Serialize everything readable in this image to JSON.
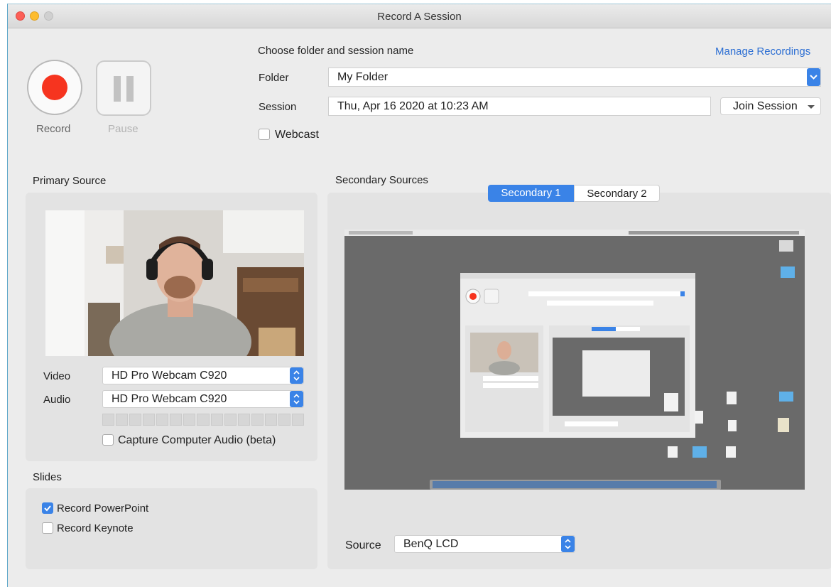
{
  "window": {
    "title": "Record A Session"
  },
  "controls": {
    "record_label": "Record",
    "pause_label": "Pause"
  },
  "session": {
    "heading": "Choose folder and session name",
    "manage_link": "Manage Recordings",
    "folder_label": "Folder",
    "folder_value": "My Folder",
    "session_label": "Session",
    "session_value": "Thu, Apr 16 2020 at 10:23 AM",
    "join_label": "Join Session",
    "webcast_label": "Webcast"
  },
  "primary": {
    "heading": "Primary Source",
    "video_label": "Video",
    "video_value": "HD Pro Webcam C920",
    "audio_label": "Audio",
    "audio_value": "HD Pro Webcam C920",
    "capture_audio_label": "Capture Computer Audio (beta)",
    "capture_audio_checked": false
  },
  "slides": {
    "heading": "Slides",
    "powerpoint_label": "Record PowerPoint",
    "powerpoint_checked": true,
    "keynote_label": "Record Keynote",
    "keynote_checked": false
  },
  "secondary": {
    "heading": "Secondary Sources",
    "tabs": [
      {
        "label": "Secondary 1",
        "active": true
      },
      {
        "label": "Secondary 2",
        "active": false
      }
    ],
    "source_label": "Source",
    "source_value": "BenQ LCD"
  },
  "colors": {
    "accent": "#3a83e7",
    "record": "#f6341f",
    "link": "#2d6fd3"
  }
}
